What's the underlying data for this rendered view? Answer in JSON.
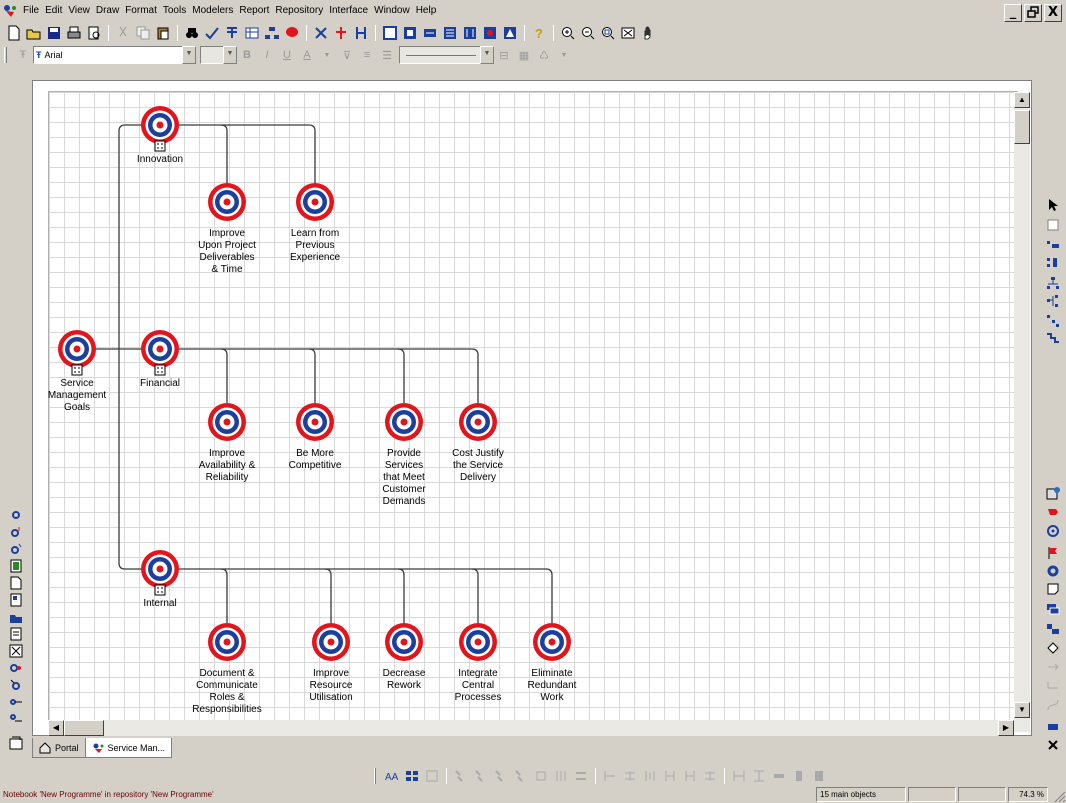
{
  "menubar": {
    "items": [
      "File",
      "Edit",
      "View",
      "Draw",
      "Format",
      "Tools",
      "Modelers",
      "Report",
      "Repository",
      "Interface",
      "Window",
      "Help"
    ]
  },
  "window_controls": {
    "minimize": "_",
    "restore": "т",
    "close": "X"
  },
  "format_toolbar": {
    "font_name": "Arial",
    "bold": "B",
    "italic": "I",
    "underline": "U",
    "font_color": "A"
  },
  "tabs": [
    {
      "label": "Portal",
      "active": false
    },
    {
      "label": "Service Man...",
      "active": true
    }
  ],
  "statusbar": {
    "message": "Notebook 'New Programme' in repository 'New Programme'",
    "objects": "15 main objects",
    "zoom": "74.3 %"
  },
  "colors": {
    "target_red": "#e2141c",
    "target_blue": "#1a3f9e",
    "connector": "#3a3a3a",
    "status_text": "#6a0000"
  },
  "diagram": {
    "root": {
      "label": "Service\nManagement\nGoals"
    },
    "groups": [
      {
        "label": "Innovation",
        "children": [
          {
            "label": "Improve\nUpon Project\nDeliverables\n& Time"
          },
          {
            "label": "Learn from\nPrevious\nExperience"
          }
        ]
      },
      {
        "label": "Financial",
        "children": [
          {
            "label": "Improve\nAvailability &\nReliability"
          },
          {
            "label": "Be More\nCompetitive"
          },
          {
            "label": "Provide\nServices\nthat Meet\nCustomer\nDemands"
          },
          {
            "label": "Cost Justify\nthe Service\nDelivery"
          }
        ]
      },
      {
        "label": "Internal",
        "children": [
          {
            "label": "Document &\nCommunicate\nRoles &\nResponsibilities"
          },
          {
            "label": "Improve\nResource\nUtilisation"
          },
          {
            "label": "Decrease\nRework"
          },
          {
            "label": "Integrate\nCentral\nProcesses"
          },
          {
            "label": "Eliminate\nRedundant\nWork"
          }
        ]
      }
    ]
  }
}
